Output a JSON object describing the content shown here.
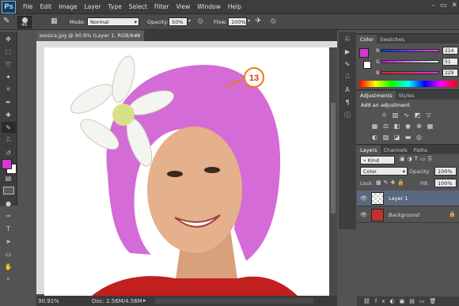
{
  "app": {
    "logo": "Ps"
  },
  "menubar": {
    "items": [
      "File",
      "Edit",
      "Image",
      "Layer",
      "Type",
      "Select",
      "Filter",
      "View",
      "Window",
      "Help"
    ]
  },
  "options": {
    "brush_size": "40",
    "mode_label": "Mode:",
    "mode_value": "Normal",
    "opacity_label": "Opacity:",
    "opacity_value": "50%",
    "flow_label": "Flow:",
    "flow_value": "100%"
  },
  "document": {
    "tab_title": "jessica.jpg @ 90.9% (Layer 1, RGB/8#) *",
    "annotation_number": "13"
  },
  "status": {
    "zoom": "90.91%",
    "doc": "Doc: 2.56M/4.56M"
  },
  "colors": {
    "foreground": "#d637d6",
    "background": "#ffffff",
    "hair": "#d46bd6",
    "skin": "#e5b08c",
    "dress": "#c21f1f",
    "accent_orange": "#f07a10"
  },
  "color_panel": {
    "tabs": [
      "Color",
      "Swatches"
    ],
    "channels": [
      {
        "label": "R",
        "value": "214"
      },
      {
        "label": "G",
        "value": "51"
      },
      {
        "label": "B",
        "value": "229"
      }
    ]
  },
  "adjustments_panel": {
    "tabs": [
      "Adjustments",
      "Styles"
    ],
    "heading": "Add an adjustment"
  },
  "layers_panel": {
    "tabs": [
      "Layers",
      "Channels",
      "Paths"
    ],
    "filter_value": "Kind",
    "blend_mode": "Color",
    "opacity_label": "Opacity:",
    "opacity_value": "100%",
    "lock_label": "Lock:",
    "fill_label": "Fill:",
    "fill_value": "100%",
    "layers": [
      {
        "name": "Layer 1"
      },
      {
        "name": "Background"
      }
    ]
  }
}
